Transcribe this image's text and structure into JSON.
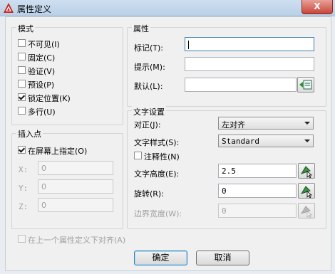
{
  "window": {
    "title": "属性定义",
    "close_label": "X"
  },
  "mode": {
    "title": "模式",
    "options": [
      {
        "label": "不可见(I)",
        "checked": false
      },
      {
        "label": "固定(C)",
        "checked": false
      },
      {
        "label": "验证(V)",
        "checked": false
      },
      {
        "label": "预设(P)",
        "checked": false
      },
      {
        "label": "锁定位置(K)",
        "checked": true
      },
      {
        "label": "多行(U)",
        "checked": false
      }
    ]
  },
  "insert_point": {
    "title": "插入点",
    "specify_on_screen": {
      "label": "在屏幕上指定(O)",
      "checked": true
    },
    "x": {
      "label": "X:",
      "value": "0"
    },
    "y": {
      "label": "Y:",
      "value": "0"
    },
    "z": {
      "label": "Z:",
      "value": "0"
    }
  },
  "attribute": {
    "title": "属性",
    "tag": {
      "label": "标记(T):",
      "value": ""
    },
    "prompt": {
      "label": "提示(M):",
      "value": ""
    },
    "default": {
      "label": "默认(L):",
      "value": ""
    }
  },
  "text_settings": {
    "title": "文字设置",
    "justify": {
      "label": "对正(J):",
      "value": "左对齐"
    },
    "text_style": {
      "label": "文字样式(S):",
      "value": "Standard"
    },
    "annotative": {
      "label": "注释性(N)",
      "checked": false
    },
    "text_height": {
      "label": "文字高度(E):",
      "value": "2.5"
    },
    "rotation": {
      "label": "旋转(R):",
      "value": "0"
    },
    "boundary_width": {
      "label": "边界宽度(W):",
      "value": "0"
    }
  },
  "align_below": {
    "label": "在上一个属性定义下对齐(A)",
    "checked": false
  },
  "buttons": {
    "ok": "确定",
    "cancel": "取消"
  }
}
